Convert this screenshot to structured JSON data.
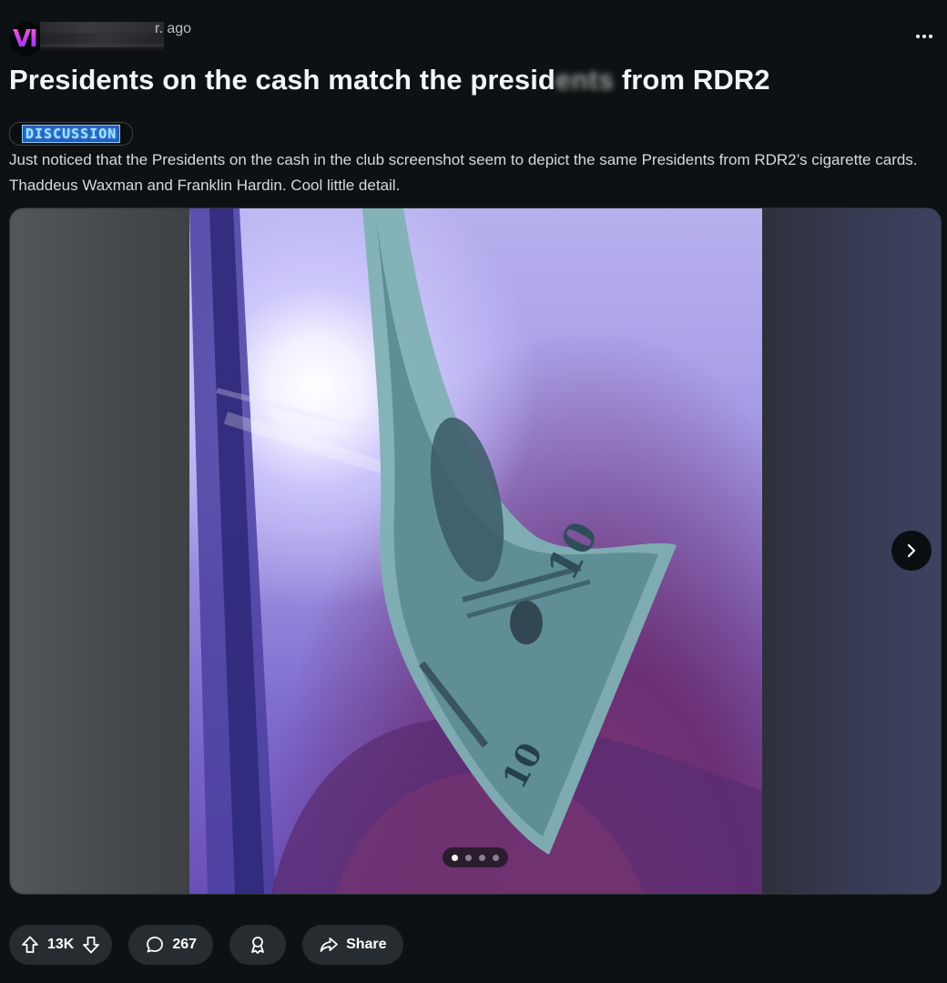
{
  "header": {
    "avatar_glyph": "VI",
    "timestamp": "r. ago",
    "more_label": "…"
  },
  "post": {
    "title_start": "Presidents on the cash match the presid",
    "title_end": "from RDR2",
    "flair": "DISCUSSION",
    "body": "Just noticed that the Presidents on the cash in the club screenshot seem to depict the same Presidents from RDR2’s cigarette cards. Thaddeus Waxman and Franklin Hardin. Cool little detail."
  },
  "gallery": {
    "current_index": 1,
    "total_images": 4,
    "bill_denomination": "10"
  },
  "actions": {
    "upvotes": "13K",
    "comments": "267",
    "share_label": "Share"
  },
  "colors": {
    "background": "#0e1113",
    "pill": "#262c2f",
    "flair_bg": "#2a57b8",
    "flair_text": "#9fe6ff"
  },
  "icons": [
    "more-dots-icon",
    "chevron-right-icon",
    "upvote-arrow-icon",
    "downvote-arrow-icon",
    "comment-bubble-icon",
    "award-icon",
    "share-arrow-icon"
  ]
}
